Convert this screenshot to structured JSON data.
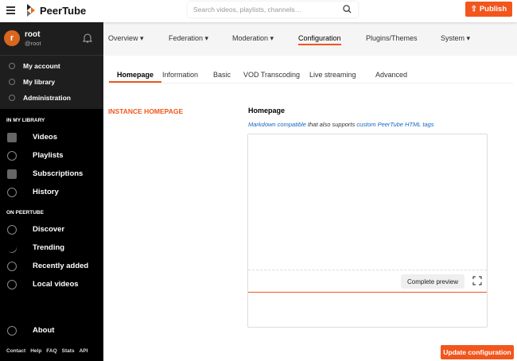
{
  "header": {
    "brand": "PeerTube",
    "search_placeholder": "Search videos, playlists, channels…",
    "publish": "Publish"
  },
  "user": {
    "initial": "r",
    "name": "root",
    "handle": "@root"
  },
  "account_menu": [
    "My account",
    "My library",
    "Administration"
  ],
  "library": {
    "title": "IN MY LIBRARY",
    "items": [
      {
        "label": "Videos",
        "icon": "videos-icon"
      },
      {
        "label": "Playlists",
        "icon": "list-icon"
      },
      {
        "label": "Subscriptions",
        "icon": "subscriptions-icon"
      },
      {
        "label": "History",
        "icon": "history-icon"
      }
    ]
  },
  "peertube": {
    "title": "ON PEERTUBE",
    "items": [
      {
        "label": "Discover",
        "icon": "globe-icon"
      },
      {
        "label": "Trending",
        "icon": "trending-icon"
      },
      {
        "label": "Recently added",
        "icon": "plus-circle-icon"
      },
      {
        "label": "Local videos",
        "icon": "location-icon"
      }
    ]
  },
  "about": "About",
  "footer": [
    "Contact",
    "Help",
    "FAQ",
    "Stats",
    "API"
  ],
  "admin_nav": [
    {
      "label": "Overview ▾"
    },
    {
      "label": "Federation ▾"
    },
    {
      "label": "Moderation ▾"
    },
    {
      "label": "Configuration",
      "active": true
    },
    {
      "label": "Plugins/Themes"
    },
    {
      "label": "System ▾"
    }
  ],
  "tabs": [
    {
      "label": "Homepage",
      "active": true
    },
    {
      "label": "Information"
    },
    {
      "label": "Basic"
    },
    {
      "label": "VOD Transcoding"
    },
    {
      "label": "Live streaming"
    },
    {
      "label": "Advanced"
    }
  ],
  "section_title": "INSTANCE HOMEPAGE",
  "field": {
    "label": "Homepage",
    "help_link1": "Markdown compatible",
    "help_mid": " that also supports ",
    "help_link2": "custom PeerTube HTML tags",
    "value": ""
  },
  "preview_button": "Complete preview",
  "update_button": "Update configuration",
  "colors": {
    "accent": "#f2561d",
    "sidebar": "#000000"
  }
}
